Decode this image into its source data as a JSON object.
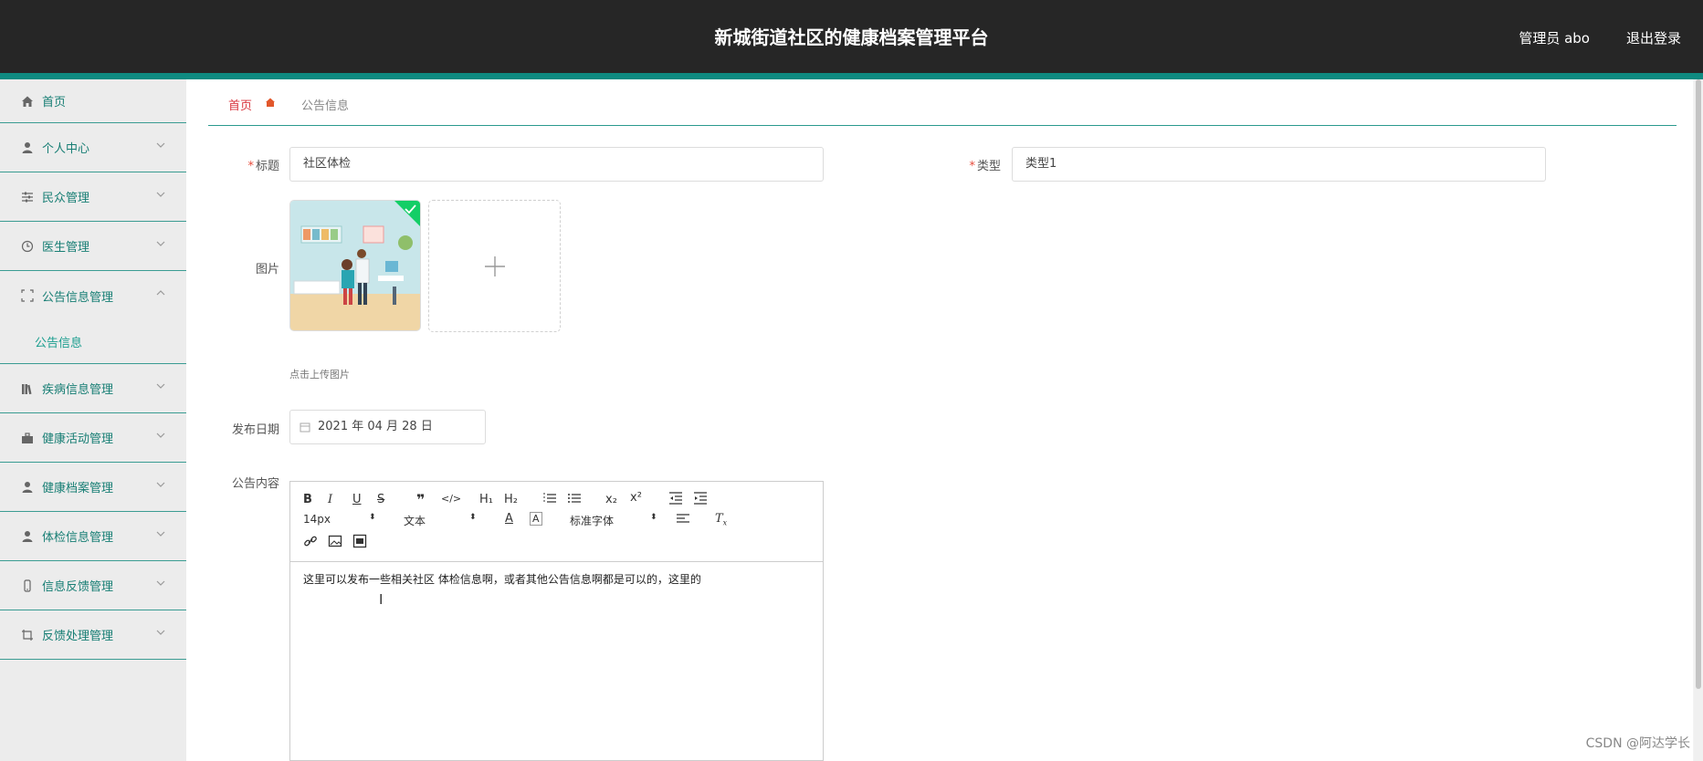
{
  "header": {
    "title": "新城街道社区的健康档案管理平台",
    "user_label": "管理员 abo",
    "logout_label": "退出登录"
  },
  "sidebar": {
    "items": [
      {
        "label": "首页",
        "icon": "home-icon"
      },
      {
        "label": "个人中心",
        "icon": "user-icon"
      },
      {
        "label": "民众管理",
        "icon": "sliders-icon"
      },
      {
        "label": "医生管理",
        "icon": "clock-icon"
      },
      {
        "label": "公告信息管理",
        "icon": "frame-icon",
        "expanded": true,
        "children": [
          "公告信息"
        ]
      },
      {
        "label": "疾病信息管理",
        "icon": "books-icon"
      },
      {
        "label": "健康活动管理",
        "icon": "briefcase-icon"
      },
      {
        "label": "健康档案管理",
        "icon": "user-icon"
      },
      {
        "label": "体检信息管理",
        "icon": "user-icon"
      },
      {
        "label": "信息反馈管理",
        "icon": "phone-icon"
      },
      {
        "label": "反馈处理管理",
        "icon": "crop-icon"
      }
    ],
    "active_color": "#1b9e8f"
  },
  "breadcrumb": {
    "home": "首页",
    "current": "公告信息"
  },
  "form": {
    "title_label": "标题",
    "title_value": "社区体检",
    "type_label": "类型",
    "type_value": "类型1",
    "image_label": "图片",
    "upload_hint": "点击上传图片",
    "date_label": "发布日期",
    "date_value": "2021 年 04 月 28 日",
    "content_label": "公告内容",
    "required_mark": "*"
  },
  "editor": {
    "font_size": "14px",
    "block_type": "文本",
    "font_family": "标准字体",
    "content": "这里可以发布一些相关社区 体检信息啊，或者其他公告信息啊都是可以的，这里的"
  },
  "watermark": "CSDN @阿达学长",
  "colors": {
    "topbar": "#262626",
    "accent": "#0e8a80",
    "breadcrumb_home": "#d9363e"
  }
}
